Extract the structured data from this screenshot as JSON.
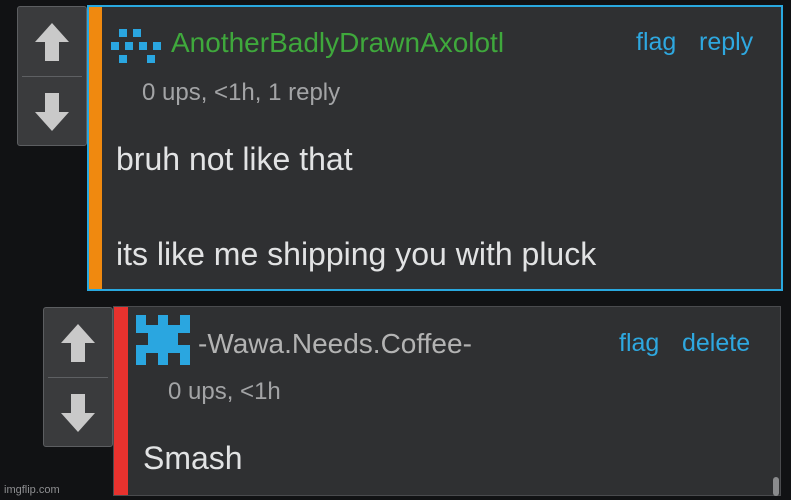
{
  "colors": {
    "background": "#111214",
    "panel": "#2f3032",
    "link": "#2ea8e0",
    "selected_border": "#29a8df",
    "username_green": "#3fa83c",
    "username_gray": "#b3b3b3",
    "bar_orange": "#f0890f",
    "bar_red": "#e8322e",
    "avatar_blue": "#2aa6e0"
  },
  "comments": [
    {
      "username": "AnotherBadlyDrawnAxolotl",
      "meta": "0 ups, <1h, 1 reply",
      "body": [
        "bruh not like that",
        "its like me shipping you with pluck"
      ],
      "actions": [
        "flag",
        "reply"
      ]
    },
    {
      "username": "-Wawa.Needs.Coffee-",
      "meta": "0 ups, <1h",
      "body": [
        "Smash"
      ],
      "actions": [
        "flag",
        "delete"
      ]
    }
  ],
  "icons": {
    "upvote": "arrow-up-icon",
    "downvote": "arrow-down-icon",
    "avatar1": "pixel-face-avatar",
    "avatar2": "pixel-castle-avatar"
  },
  "watermark": "imgflip.com"
}
